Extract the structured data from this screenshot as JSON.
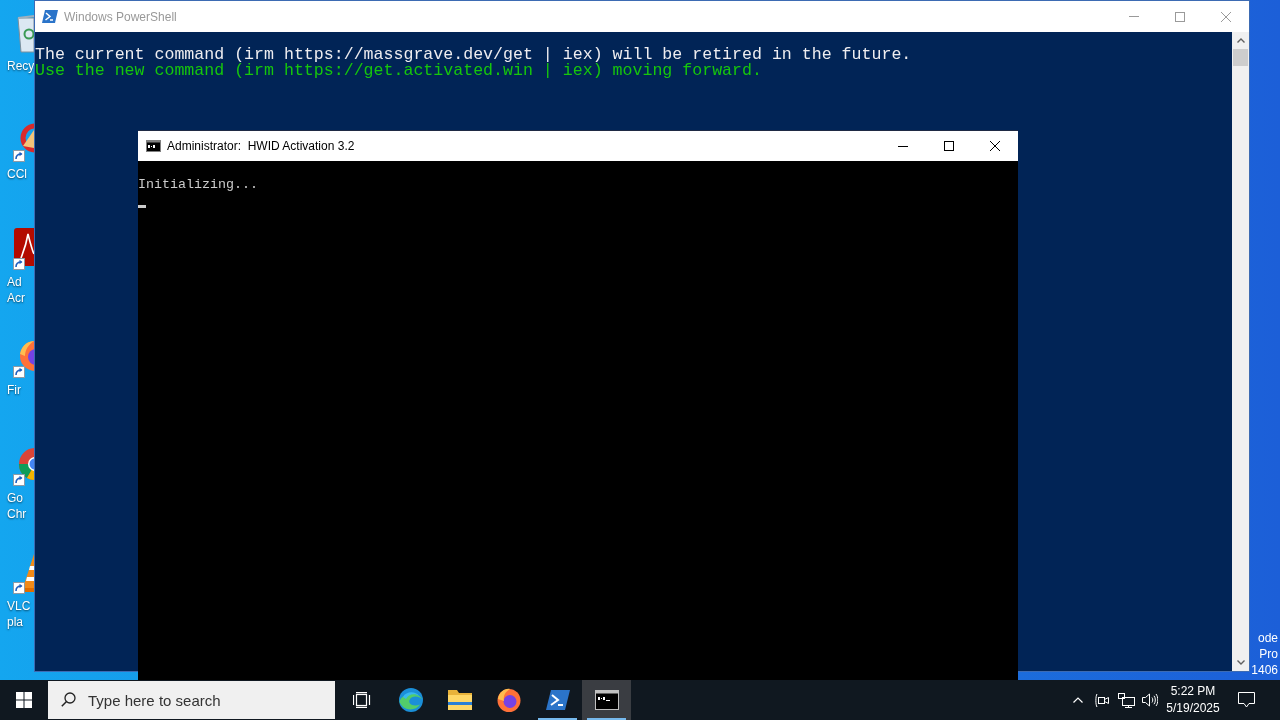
{
  "desktop": {
    "icons": [
      {
        "kind": "bin",
        "label_lines": [
          "Recy"
        ]
      },
      {
        "kind": "cleaner",
        "label_lines": [
          "CCl"
        ]
      },
      {
        "kind": "pdf",
        "label_lines": [
          "Ad",
          "Acr"
        ]
      },
      {
        "kind": "fox",
        "label_lines": [
          "Fir"
        ]
      },
      {
        "kind": "globe",
        "label_lines": [
          "Go",
          "Chr"
        ]
      },
      {
        "kind": "cone",
        "label_lines": [
          "VLC",
          "pla"
        ]
      }
    ],
    "edition_lines": [
      "ode",
      "Pro",
      "1406"
    ]
  },
  "powershell_window": {
    "title": "Windows PowerShell",
    "active": false,
    "lines": [
      {
        "text": "The current command (irm https://massgrave.dev/get | iex) will be retired in the future.",
        "color": "#eeedf0"
      },
      {
        "text": "Use the new command (irm https://get.activated.win | iex) moving forward.",
        "color": "#16c60c"
      }
    ]
  },
  "cmd_window": {
    "title": "Administrator:  HWID Activation 3.2",
    "active": true,
    "lines": [
      "Initializing..."
    ],
    "cursor_visible": true
  },
  "taskbar": {
    "search": {
      "placeholder": "Type here to search"
    },
    "apps": [
      {
        "kind": "edge",
        "running": false,
        "selected": false
      },
      {
        "kind": "folder",
        "running": false,
        "selected": false
      },
      {
        "kind": "fox",
        "running": false,
        "selected": false
      },
      {
        "kind": "powershell",
        "running": true,
        "selected": false
      },
      {
        "kind": "console",
        "running": true,
        "selected": true
      }
    ],
    "clock": {
      "time": "5:22 PM",
      "date": "5/19/2025"
    }
  }
}
